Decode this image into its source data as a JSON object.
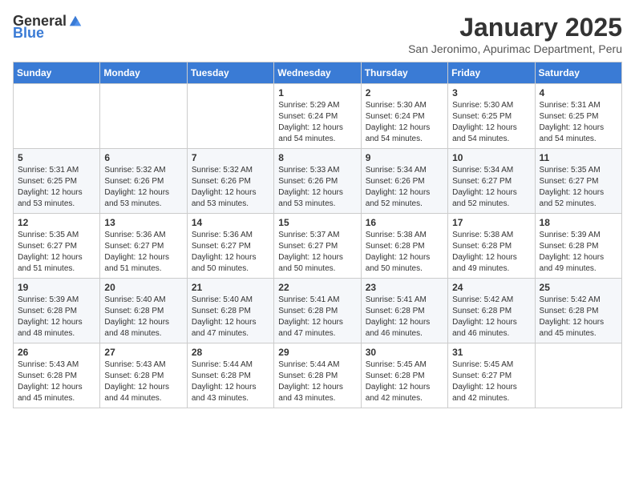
{
  "logo": {
    "text_general": "General",
    "text_blue": "Blue"
  },
  "title": "January 2025",
  "subtitle": "San Jeronimo, Apurimac Department, Peru",
  "days_of_week": [
    "Sunday",
    "Monday",
    "Tuesday",
    "Wednesday",
    "Thursday",
    "Friday",
    "Saturday"
  ],
  "weeks": [
    [
      {
        "day": "",
        "info": ""
      },
      {
        "day": "",
        "info": ""
      },
      {
        "day": "",
        "info": ""
      },
      {
        "day": "1",
        "info": "Sunrise: 5:29 AM\nSunset: 6:24 PM\nDaylight: 12 hours\nand 54 minutes."
      },
      {
        "day": "2",
        "info": "Sunrise: 5:30 AM\nSunset: 6:24 PM\nDaylight: 12 hours\nand 54 minutes."
      },
      {
        "day": "3",
        "info": "Sunrise: 5:30 AM\nSunset: 6:25 PM\nDaylight: 12 hours\nand 54 minutes."
      },
      {
        "day": "4",
        "info": "Sunrise: 5:31 AM\nSunset: 6:25 PM\nDaylight: 12 hours\nand 54 minutes."
      }
    ],
    [
      {
        "day": "5",
        "info": "Sunrise: 5:31 AM\nSunset: 6:25 PM\nDaylight: 12 hours\nand 53 minutes."
      },
      {
        "day": "6",
        "info": "Sunrise: 5:32 AM\nSunset: 6:26 PM\nDaylight: 12 hours\nand 53 minutes."
      },
      {
        "day": "7",
        "info": "Sunrise: 5:32 AM\nSunset: 6:26 PM\nDaylight: 12 hours\nand 53 minutes."
      },
      {
        "day": "8",
        "info": "Sunrise: 5:33 AM\nSunset: 6:26 PM\nDaylight: 12 hours\nand 53 minutes."
      },
      {
        "day": "9",
        "info": "Sunrise: 5:34 AM\nSunset: 6:26 PM\nDaylight: 12 hours\nand 52 minutes."
      },
      {
        "day": "10",
        "info": "Sunrise: 5:34 AM\nSunset: 6:27 PM\nDaylight: 12 hours\nand 52 minutes."
      },
      {
        "day": "11",
        "info": "Sunrise: 5:35 AM\nSunset: 6:27 PM\nDaylight: 12 hours\nand 52 minutes."
      }
    ],
    [
      {
        "day": "12",
        "info": "Sunrise: 5:35 AM\nSunset: 6:27 PM\nDaylight: 12 hours\nand 51 minutes."
      },
      {
        "day": "13",
        "info": "Sunrise: 5:36 AM\nSunset: 6:27 PM\nDaylight: 12 hours\nand 51 minutes."
      },
      {
        "day": "14",
        "info": "Sunrise: 5:36 AM\nSunset: 6:27 PM\nDaylight: 12 hours\nand 50 minutes."
      },
      {
        "day": "15",
        "info": "Sunrise: 5:37 AM\nSunset: 6:27 PM\nDaylight: 12 hours\nand 50 minutes."
      },
      {
        "day": "16",
        "info": "Sunrise: 5:38 AM\nSunset: 6:28 PM\nDaylight: 12 hours\nand 50 minutes."
      },
      {
        "day": "17",
        "info": "Sunrise: 5:38 AM\nSunset: 6:28 PM\nDaylight: 12 hours\nand 49 minutes."
      },
      {
        "day": "18",
        "info": "Sunrise: 5:39 AM\nSunset: 6:28 PM\nDaylight: 12 hours\nand 49 minutes."
      }
    ],
    [
      {
        "day": "19",
        "info": "Sunrise: 5:39 AM\nSunset: 6:28 PM\nDaylight: 12 hours\nand 48 minutes."
      },
      {
        "day": "20",
        "info": "Sunrise: 5:40 AM\nSunset: 6:28 PM\nDaylight: 12 hours\nand 48 minutes."
      },
      {
        "day": "21",
        "info": "Sunrise: 5:40 AM\nSunset: 6:28 PM\nDaylight: 12 hours\nand 47 minutes."
      },
      {
        "day": "22",
        "info": "Sunrise: 5:41 AM\nSunset: 6:28 PM\nDaylight: 12 hours\nand 47 minutes."
      },
      {
        "day": "23",
        "info": "Sunrise: 5:41 AM\nSunset: 6:28 PM\nDaylight: 12 hours\nand 46 minutes."
      },
      {
        "day": "24",
        "info": "Sunrise: 5:42 AM\nSunset: 6:28 PM\nDaylight: 12 hours\nand 46 minutes."
      },
      {
        "day": "25",
        "info": "Sunrise: 5:42 AM\nSunset: 6:28 PM\nDaylight: 12 hours\nand 45 minutes."
      }
    ],
    [
      {
        "day": "26",
        "info": "Sunrise: 5:43 AM\nSunset: 6:28 PM\nDaylight: 12 hours\nand 45 minutes."
      },
      {
        "day": "27",
        "info": "Sunrise: 5:43 AM\nSunset: 6:28 PM\nDaylight: 12 hours\nand 44 minutes."
      },
      {
        "day": "28",
        "info": "Sunrise: 5:44 AM\nSunset: 6:28 PM\nDaylight: 12 hours\nand 43 minutes."
      },
      {
        "day": "29",
        "info": "Sunrise: 5:44 AM\nSunset: 6:28 PM\nDaylight: 12 hours\nand 43 minutes."
      },
      {
        "day": "30",
        "info": "Sunrise: 5:45 AM\nSunset: 6:28 PM\nDaylight: 12 hours\nand 42 minutes."
      },
      {
        "day": "31",
        "info": "Sunrise: 5:45 AM\nSunset: 6:27 PM\nDaylight: 12 hours\nand 42 minutes."
      },
      {
        "day": "",
        "info": ""
      }
    ]
  ]
}
